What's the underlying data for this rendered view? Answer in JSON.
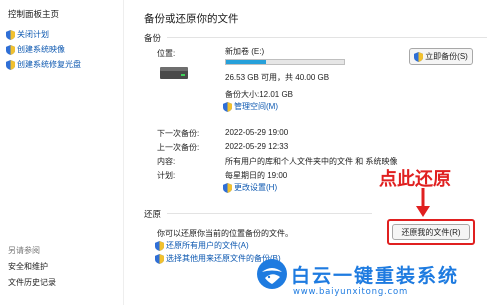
{
  "sidebar": {
    "title": "控制面板主页",
    "items": [
      {
        "label": "关闭计划"
      },
      {
        "label": "创建系统映像"
      },
      {
        "label": "创建系统修复光盘"
      }
    ],
    "see_also_title": "另请参阅",
    "see_also": [
      {
        "label": "安全和维护"
      },
      {
        "label": "文件历史记录"
      }
    ]
  },
  "page": {
    "title": "备份或还原你的文件"
  },
  "backup": {
    "section": "备份",
    "location_label": "位置:",
    "drive_name": "新加卷 (E:)",
    "drive_space": "26.53 GB 可用，共 40.00 GB",
    "drive_used_fraction": 0.34,
    "backup_size": "备份大小:12.01 GB",
    "manage_space": "管理空间(M)",
    "backup_now": "立即备份(S)",
    "next_label": "下一次备份:",
    "next_value": "2022-05-29 19:00",
    "last_label": "上一次备份:",
    "last_value": "2022-05-29 12:33",
    "contents_label": "内容:",
    "contents_value": "所有用户的库和个人文件夹中的文件 和 系统映像",
    "schedule_label": "计划:",
    "schedule_value": "每星期日的 19:00",
    "change_settings": "更改设置(H)"
  },
  "restore": {
    "section": "还原",
    "description": "你可以还原你当前的位置备份的文件。",
    "restore_button": "还原我的文件(R)",
    "restore_all": "还原所有用户的文件(A)",
    "select_other": "选择其他用来还原文件的备份(B)"
  },
  "annotation": {
    "text": "点此还原",
    "color": "#e02020"
  },
  "watermark": {
    "brand": "白云一键重装系统",
    "url": "www.baiyunxitong.com",
    "color": "#1e7be0"
  }
}
